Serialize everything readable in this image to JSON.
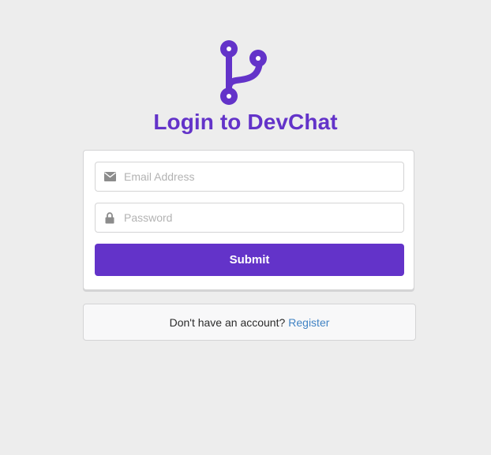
{
  "brand": {
    "title": "Login to DevChat",
    "accent_color": "#6333c9",
    "logo_icon": "code-branch-icon"
  },
  "form": {
    "email": {
      "value": "",
      "placeholder": "Email Address",
      "icon": "mail-icon"
    },
    "password": {
      "value": "",
      "placeholder": "Password",
      "icon": "lock-icon"
    },
    "submit_label": "Submit"
  },
  "footer": {
    "prompt": "Don't have an account?",
    "register_link": "Register",
    "link_color": "#4183c4"
  }
}
